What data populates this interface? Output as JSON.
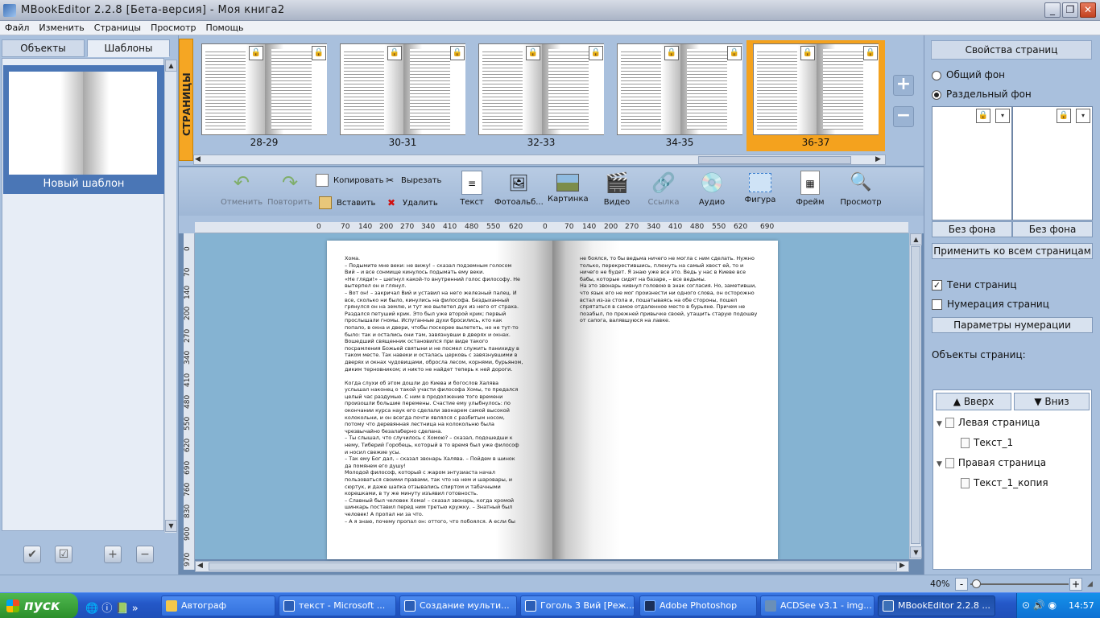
{
  "window": {
    "title": "MBookEditor 2.2.8 [Бета-версия] - Моя книга2",
    "min": "_",
    "max": "❐",
    "close": "✕"
  },
  "menu": [
    "Файл",
    "Изменить",
    "Страницы",
    "Просмотр",
    "Помощь"
  ],
  "left": {
    "tabs": [
      "Объекты",
      "Шаблоны"
    ],
    "template_label": "Новый шаблон"
  },
  "pages": {
    "strip_title": "СТРАНИЦЫ",
    "thumbs": [
      "28-29",
      "30-31",
      "32-33",
      "34-35",
      "36-37"
    ],
    "selected": "36-37"
  },
  "toolbar": {
    "undo": "Отменить",
    "redo": "Повторить",
    "copy": "Копировать",
    "cut": "Вырезать",
    "paste": "Вставить",
    "delete": "Удалить",
    "text": "Текст",
    "album": "Фотоальб...",
    "image": "Картинка",
    "video": "Видео",
    "link": "Ссылка",
    "audio": "Аудио",
    "shape": "Фигура",
    "frame": "Фрейм",
    "preview": "Просмотр"
  },
  "ruler": {
    "h": [
      "0",
      "70",
      "140",
      "200",
      "270",
      "340",
      "410",
      "480",
      "550",
      "620",
      "0",
      "70",
      "140",
      "200",
      "270",
      "340",
      "410",
      "480",
      "550",
      "620",
      "690"
    ],
    "v": [
      "0",
      "70",
      "140",
      "200",
      "270",
      "340",
      "410",
      "480",
      "550",
      "620",
      "690",
      "760",
      "830",
      "900",
      "970"
    ]
  },
  "book": {
    "left_text": "Хома.\n– Подымите мне веки: не вижу! – сказал подземным голосом Вий – и все сонмище кинулось подымать ему веки.\n«Не гляди!» – шепнул какой-то внутренний голос философу. Не вытерпел он и глянул.\n– Вот он! – закричал Вий и уставил на него железный палец. И все, сколько ни было, кинулись на философа. Бездыханный грянулся он на землю, и тут же вылетел дух из него от страха.\nРаздался петуший крик. Это был уже второй крик; первый прослышали гномы. Испуганные духи бросились, кто как попало, в окна и двери, чтобы поскорее вылететь, но не тут-то было: так и остались они там, завязнувши в дверях и окнах. Вошедший священник остановился при виде такого посрамления Божьей святыни и не посмел служить панихиду в таком месте. Так навеки и осталась церковь с завязнувшими в дверях и окнах чудовищами, обросла лесом, корнями, бурьяном, диким терновником; и никто не найдет теперь к ней дороги.\n\nКогда слухи об этом дошли до Киева и богослов Халява услышал наконец о такой участи философа Хомы, то предался целый час раздумью. С ним в продолжение того времени произошли большие перемены. Счастие ему улыбнулось: по окончании курса наук его сделали звонарем самой высокой колокольни, и он всегда почти являлся с разбитым носом, потому что деревянная лестница на колокольню была чрезвычайно безалаберно сделана.\n– Ты слышал, что случилось с Хомою? – сказал, подошедши к нему, Тиберий Горобець, который в то время был уже философ и носил свежие усы.\n– Так ему Бог дал, – сказал звонарь Халява. – Пойдем в шинок да помянем его душу!\nМолодой философ, который с жаром энтузиаста начал пользоваться своими правами, так что на нем и шаровары, и сюртук, и даже шапка отзывались спиртом и табачными корешками, в ту же минуту изъявил готовность.\n– Славный был человек Хома! – сказал звонарь, когда хромой шинкарь поставил перед ним третью кружку. – Знатный был человек! А пропал ни за что.\n– А я знаю, почему пропал он: оттого, что побоялся. А если бы",
    "right_text": "не боялся, то бы ведьма ничего не могла с ним сделать. Нужно только, перекрестившись, плюнуть на самый хвост ей, то и ничего не будет. Я знаю уже все это. Ведь у нас в Киеве все бабы, которые сидят на базаре, – все ведьмы.\nНа это звонарь кивнул головою в знак согласия. Но, заметивши, что язык его не мог произнести ни одного слова, он осторожно встал из-за стола и, пошатываясь на обе стороны, пошел спрятаться в самое отдаленное место в бурьяне. Причем не позабыл, по прежней привычке своей, утащить старую подошву от сапога, валявшуюся на лавке."
  },
  "right": {
    "tab": "Свойства страниц",
    "common_bg": "Общий фон",
    "separate_bg": "Раздельный фон",
    "no_bg_left": "Без фона",
    "no_bg_right": "Без фона",
    "apply_all": "Применить ко всем страницам",
    "page_shadows": "Тени страниц",
    "page_numbering": "Нумерация страниц",
    "numbering_params": "Параметры нумерации",
    "objects_label": "Объекты страниц:",
    "up": "Вверх",
    "down": "Вниз",
    "tree": [
      "Левая страница",
      "Текст_1",
      "Правая страница",
      "Текст_1_копия"
    ]
  },
  "zoom": {
    "value": "40%",
    "minus": "-",
    "plus": "+",
    "level": 0.06
  },
  "taskbar": {
    "start": "пуск",
    "tasks": [
      "Автограф",
      "текст - Microsoft ...",
      "Создание мульти...",
      "Гоголь 3 Вий [Реж...",
      "Adobe Photoshop",
      "ACDSee v3.1 - img...",
      "MBookEditor 2.2.8 ..."
    ],
    "clock": "14:57"
  },
  "colors": {
    "accent": "#f5a623",
    "panel": "#a9c0dd",
    "canvas": "#85b3d2",
    "taskbar": "#2458c8"
  }
}
